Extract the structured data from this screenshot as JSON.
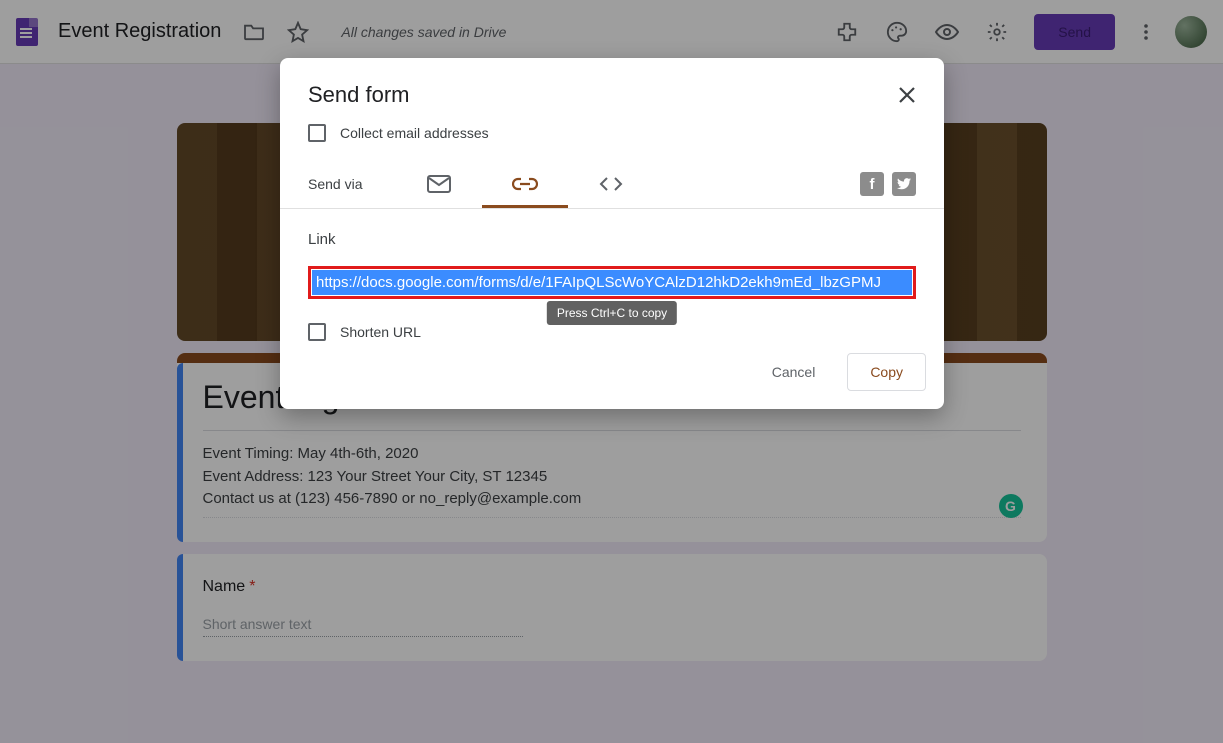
{
  "topbar": {
    "title": "Event Registration",
    "save_status": "All changes saved in Drive",
    "send_label": "Send"
  },
  "form": {
    "title": "Event registration",
    "desc_line1": "Event Timing: May 4th-6th, 2020",
    "desc_line2": "Event Address: 123 Your Street Your City, ST 12345",
    "desc_line3": "Contact us at (123) 456-7890 or no_reply@example.com",
    "q1_label": "Name",
    "q1_placeholder": "Short answer text"
  },
  "modal": {
    "title": "Send form",
    "collect_label": "Collect email addresses",
    "sendvia_label": "Send via",
    "link_label": "Link",
    "link_value": "https://docs.google.com/forms/d/e/1FAIpQLScWoYCAlzD12hkD2ekh9mEd_lbzGPMJ",
    "tooltip": "Press Ctrl+C to copy",
    "shorten_label": "Shorten URL",
    "cancel_label": "Cancel",
    "copy_label": "Copy"
  }
}
